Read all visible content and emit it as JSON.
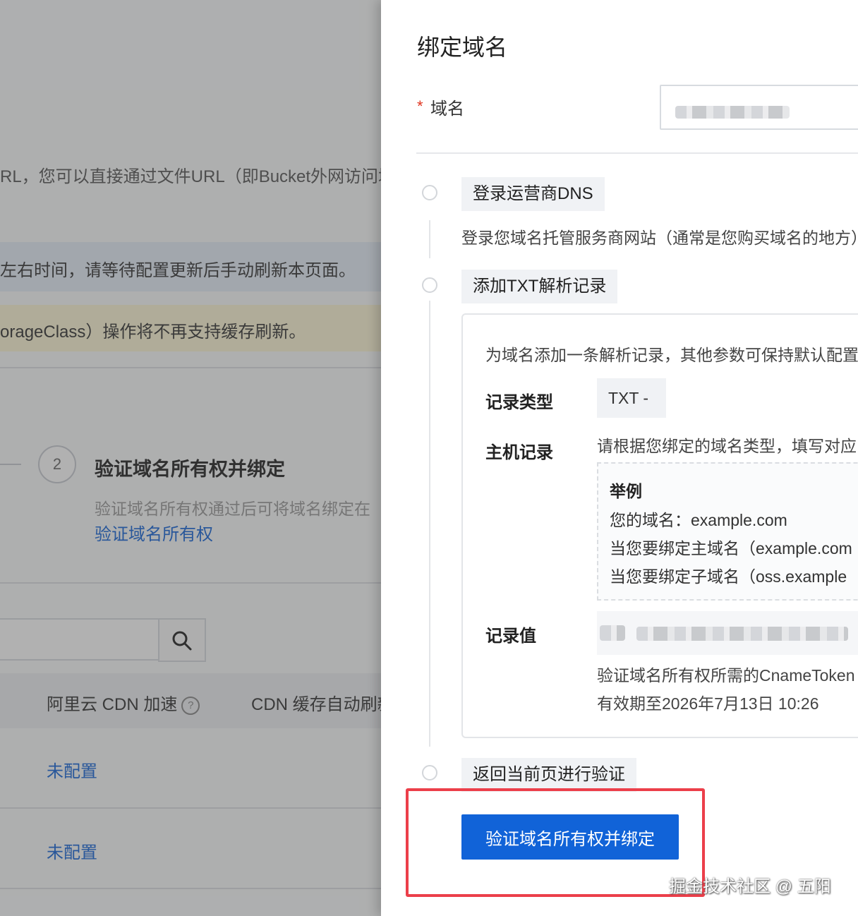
{
  "background": {
    "info_text": "RL，您可以直接通过文件URL（即Bucket外网访问域",
    "blue_notice": "左右时间，请等待配置更新后手动刷新本页面。",
    "yellow_notice": "orageClass）操作将不再支持缓存刷新。",
    "step": {
      "number": "2",
      "title": "验证域名所有权并绑定",
      "desc": "验证域名所有权通过后可将域名绑定在",
      "link": "验证域名所有权"
    },
    "table": {
      "col1": "阿里云 CDN 加速",
      "col1_help": "?",
      "col2": "CDN 缓存自动刷新",
      "rows": [
        {
          "status": "未配置"
        },
        {
          "status": "未配置"
        }
      ]
    }
  },
  "drawer": {
    "title": "绑定域名",
    "domain_field": {
      "required_mark": "*",
      "label": "域名"
    },
    "steps": [
      {
        "tag": "登录运营商DNS",
        "desc": "登录您域名托管服务商网站（通常是您购买域名的地方）"
      },
      {
        "tag": "添加TXT解析记录"
      },
      {
        "tag": "返回当前页进行验证"
      }
    ],
    "record_card": {
      "intro": "为域名添加一条解析记录，其他参数可保持默认配置",
      "type_label": "记录类型",
      "type_value": "TXT -",
      "host_label": "主机记录",
      "host_desc": "请根据您绑定的域名类型，填写对应的主机记录",
      "example": {
        "title": "举例",
        "lines": [
          "您的域名：example.com",
          "当您要绑定主域名（example.com",
          "当您要绑定子域名（oss.example"
        ]
      },
      "value_label": "记录值",
      "value_suffix": "c",
      "value_notes": [
        "验证域名所有权所需的CnameToken",
        "有效期至2026年7月13日 10:26"
      ]
    },
    "submit_button": "验证域名所有权并绑定"
  },
  "watermark": "掘金技术社区 @ 五阳",
  "colors": {
    "primary": "#1163d8",
    "link": "#1565d8",
    "highlight_border": "#ec3f4a",
    "required": "#e0341f"
  }
}
